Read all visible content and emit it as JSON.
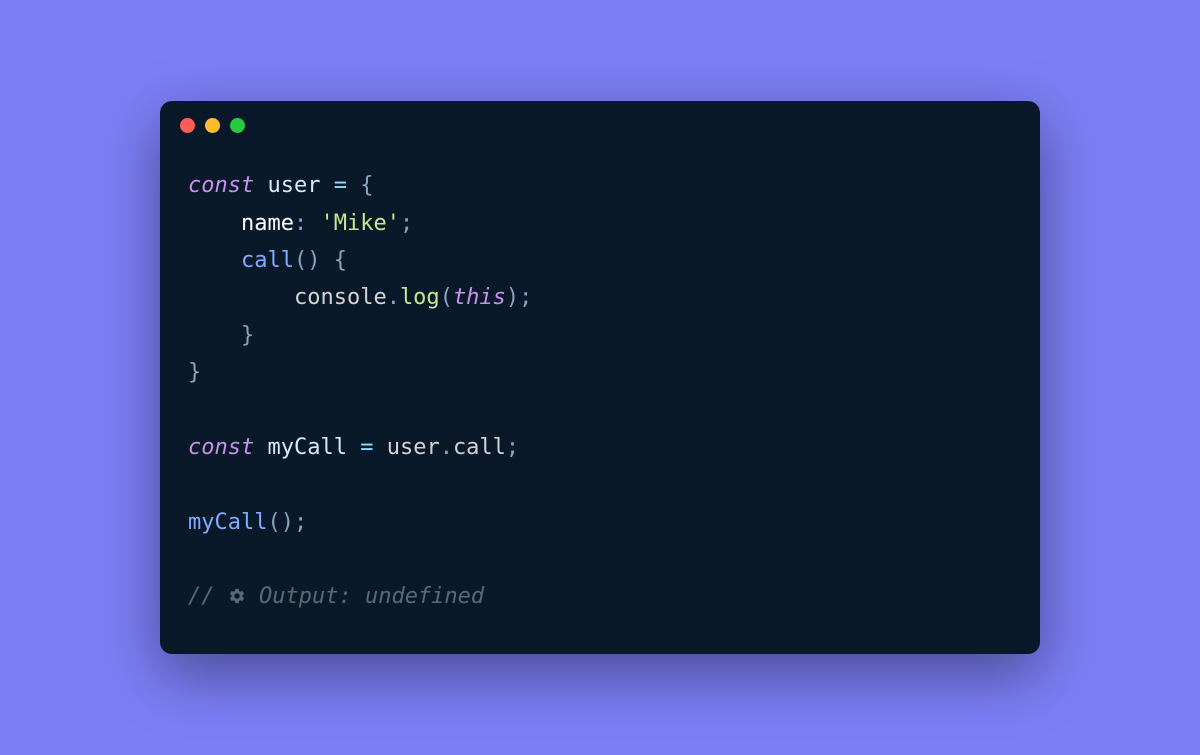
{
  "trafficLights": {
    "close": "close",
    "minimize": "minimize",
    "maximize": "maximize"
  },
  "code": {
    "line1": {
      "const": "const",
      "user": " user ",
      "equals": "= ",
      "brace": "{"
    },
    "line2": {
      "indent": "    ",
      "name": "name",
      "colon": ": ",
      "string": "'Mike'",
      "semi": ";"
    },
    "line3": {
      "indent": "    ",
      "call": "call",
      "parens": "() ",
      "brace": "{"
    },
    "line4": {
      "indent": "        ",
      "console": "console",
      "dot": ".",
      "log": "log",
      "open": "(",
      "this": "this",
      "close": ")",
      "semi": ";"
    },
    "line5": {
      "indent": "    ",
      "brace": "}"
    },
    "line6": {
      "brace": "}"
    },
    "line8": {
      "const": "const",
      "myCall": " myCall ",
      "equals": "= ",
      "user": "user",
      "dot": ".",
      "call": "call",
      "semi": ";"
    },
    "line10": {
      "myCall": "myCall",
      "parens": "()",
      "semi": ";"
    },
    "line12": {
      "slashes": "// ",
      "output": " Output: undefined"
    }
  }
}
